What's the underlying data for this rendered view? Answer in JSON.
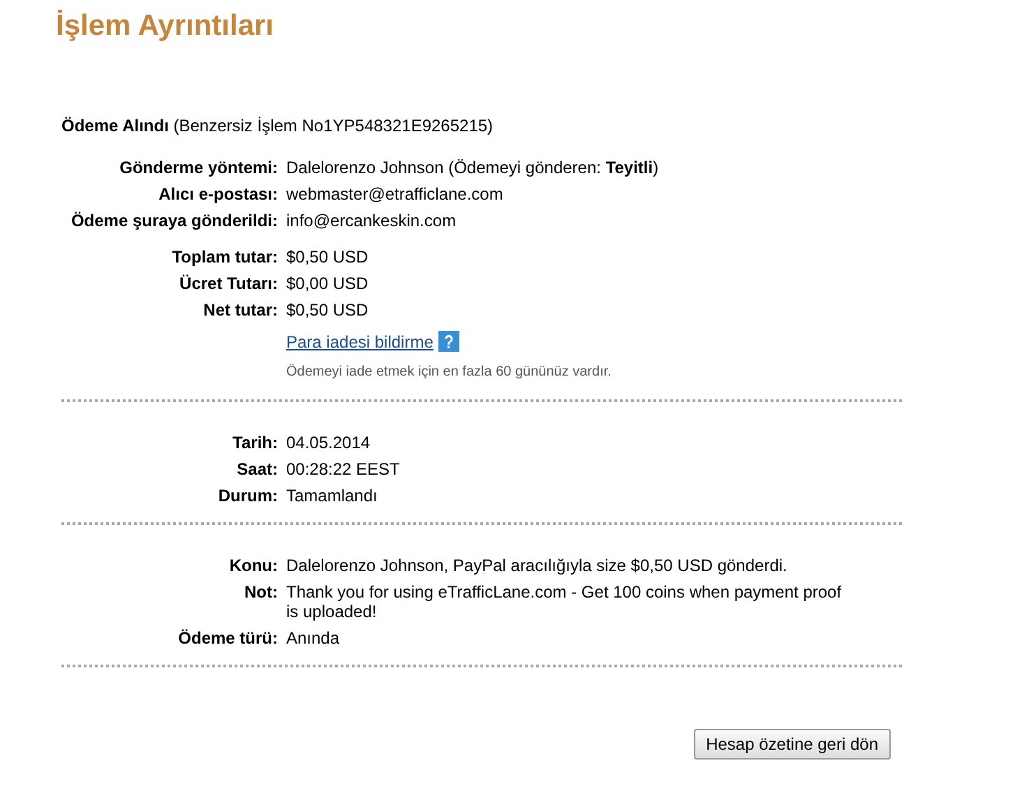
{
  "title": "İşlem Ayrıntıları",
  "summary": "**Ödeme Alındı** (Benzersiz İşlem No1YP548321E9265215)",
  "sections": [
    {
      "rows": [
        {
          "kind": "field",
          "label": "Gönderme yöntemi:",
          "value": "Dalelorenzo Johnson (Ödemeyi gönderen: **Teyitli**)"
        },
        {
          "kind": "field",
          "label": "Alıcı e-postası:",
          "value": "webmaster@etrafficlane.com"
        },
        {
          "kind": "field",
          "label": "Ödeme şuraya gönderildi:",
          "value": "info@ercankeskin.com"
        }
      ]
    },
    {
      "rows": [
        {
          "kind": "field",
          "label": "Toplam tutar:",
          "value": "$0,50 USD"
        },
        {
          "kind": "field",
          "label": "Ücret Tutarı:",
          "value": "$0,00 USD"
        },
        {
          "kind": "field",
          "label": "Net tutar:",
          "value": "$0,50 USD"
        },
        {
          "kind": "link",
          "value": "Para iadesi bildirme"
        },
        {
          "kind": "note",
          "value": "Ödemeyi iade etmek için en fazla 60 gününüz vardır."
        }
      ],
      "divider": true
    },
    {
      "rows": [
        {
          "kind": "field",
          "label": "Tarih:",
          "value": "04.05.2014"
        },
        {
          "kind": "field",
          "label": "Saat:",
          "value": "00:28:22 EEST"
        },
        {
          "kind": "field",
          "label": "Durum:",
          "value": "Tamamlandı"
        }
      ],
      "divider": true
    },
    {
      "rows": [
        {
          "kind": "field",
          "label": "Konu:",
          "value": "Dalelorenzo Johnson, PayPal aracılığıyla size $0,50 USD gönderdi."
        },
        {
          "kind": "field",
          "label": "Not:",
          "value": "Thank you for using eTrafficLane.com - Get 100 coins when payment proof is uploaded!"
        },
        {
          "kind": "field",
          "label": "Ödeme türü:",
          "value": "Anında"
        }
      ],
      "divider": true
    }
  ],
  "button": "Hesap özetine geri dön"
}
